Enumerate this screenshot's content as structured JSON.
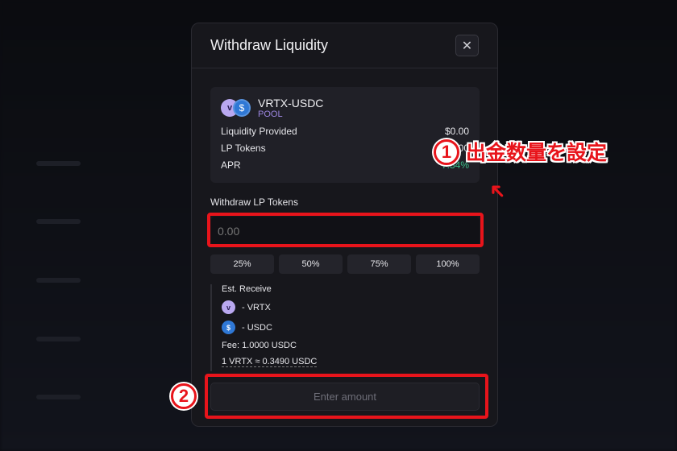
{
  "modal": {
    "title": "Withdraw Liquidity",
    "pool": {
      "name": "VRTX-USDC",
      "type": "POOL",
      "rows": [
        {
          "label": "Liquidity Provided",
          "value": "$0.00"
        },
        {
          "label": "LP Tokens",
          "value": "0.00"
        },
        {
          "label": "APR",
          "value": "7.34%"
        }
      ]
    },
    "input_label": "Withdraw LP Tokens",
    "input_placeholder": "0.00",
    "percent_buttons": [
      "25%",
      "50%",
      "75%",
      "100%"
    ],
    "est": {
      "title": "Est. Receive",
      "vrtx": "- VRTX",
      "usdc": "- USDC",
      "fee": "Fee:  1.0000 USDC",
      "rate": "1 VRTX ≈ 0.3490 USDC"
    },
    "submit": "Enter amount"
  },
  "annotations": {
    "step1_num": "1",
    "step1_text": "出金数量を設定",
    "step2_num": "2"
  },
  "colors": {
    "accent": "#e8141b",
    "apr": "#3cc08a",
    "pool_label": "#9c86e0"
  },
  "icons": [
    "close-icon",
    "vrtx-token-icon",
    "usdc-token-icon",
    "arrow-icon"
  ]
}
